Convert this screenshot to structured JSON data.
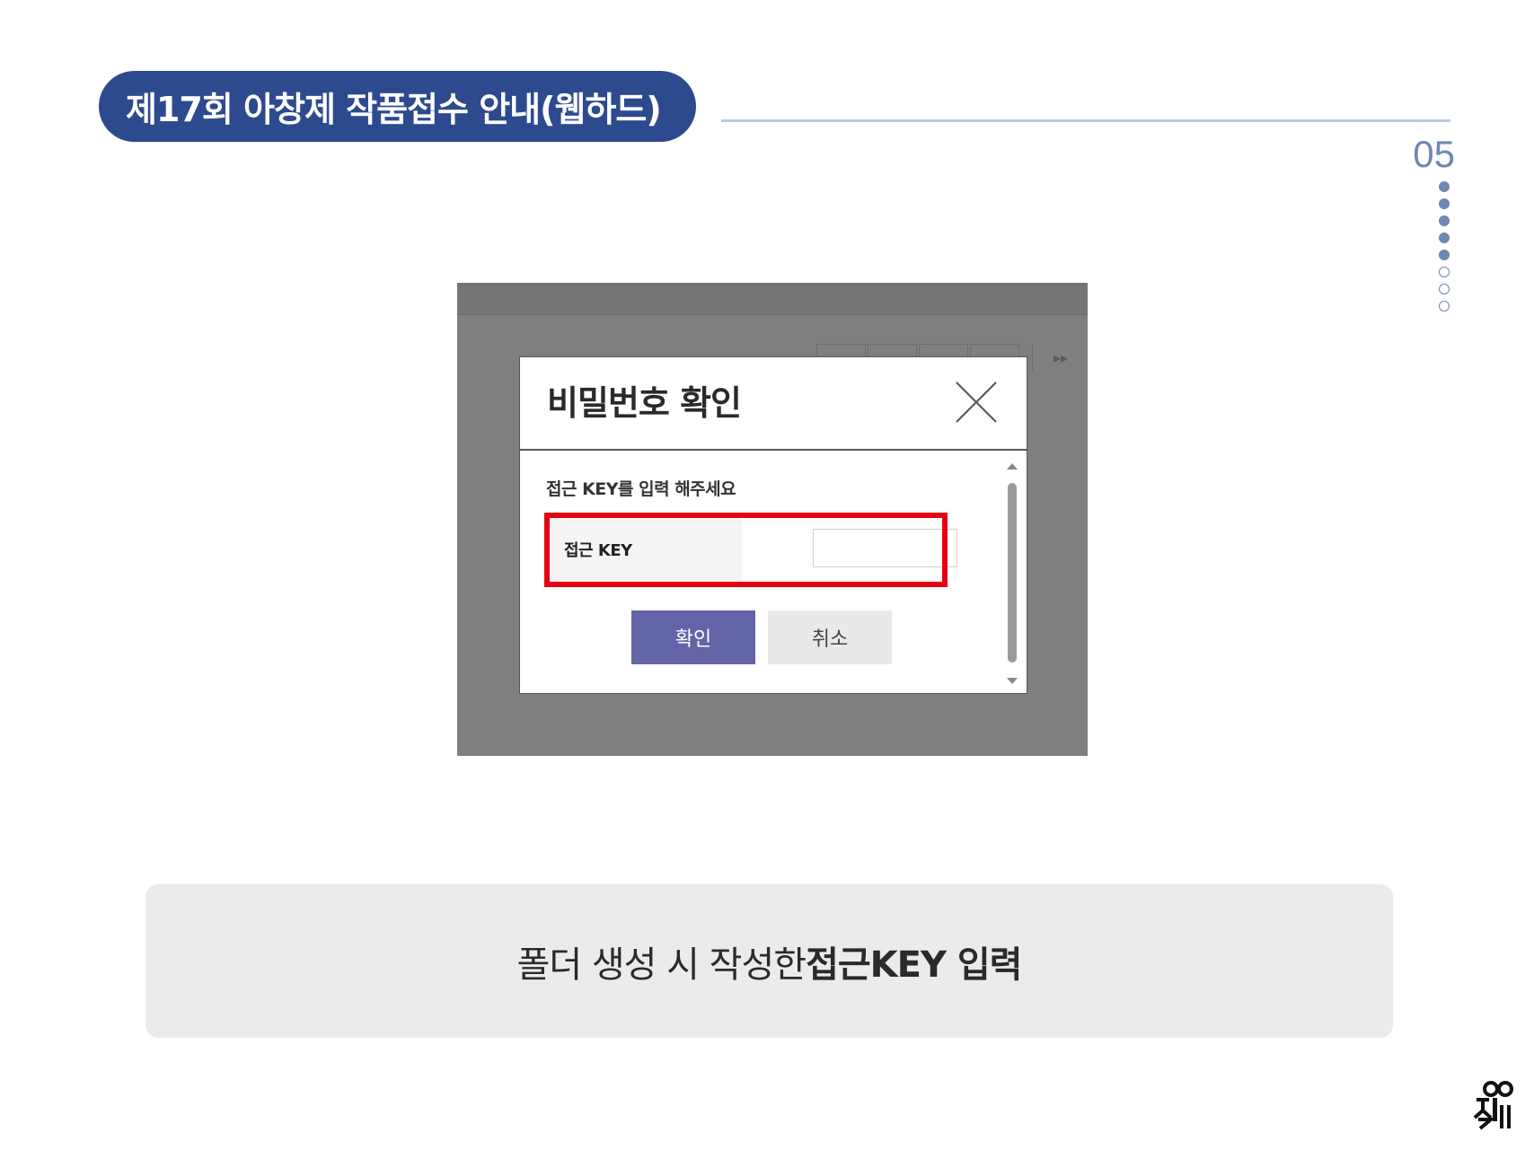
{
  "header": {
    "title": "제17회 아창제 작품접수 안내(웹하드)",
    "page_number": "05",
    "progress": {
      "total_steps": 8,
      "completed_steps": 5
    }
  },
  "dialog": {
    "title": "비밀번호 확인",
    "close_icon": "close-icon",
    "instruction": "접근 KEY를 입력 해주세요",
    "field_label": "접근 KEY",
    "field_value": "",
    "confirm_label": "확인",
    "cancel_label": "취소"
  },
  "background_ui": {
    "next_icon": "fast-forward-icon"
  },
  "caption": {
    "prefix": "폴더 생성 시 작성한 ",
    "emphasis": "접근KEY 입력"
  },
  "colors": {
    "title_pill": "#2e4a8e",
    "accent": "#6f87b2",
    "highlight": "#e60012",
    "confirm_button": "#6464a8"
  },
  "logo": {
    "text": "아창제"
  }
}
